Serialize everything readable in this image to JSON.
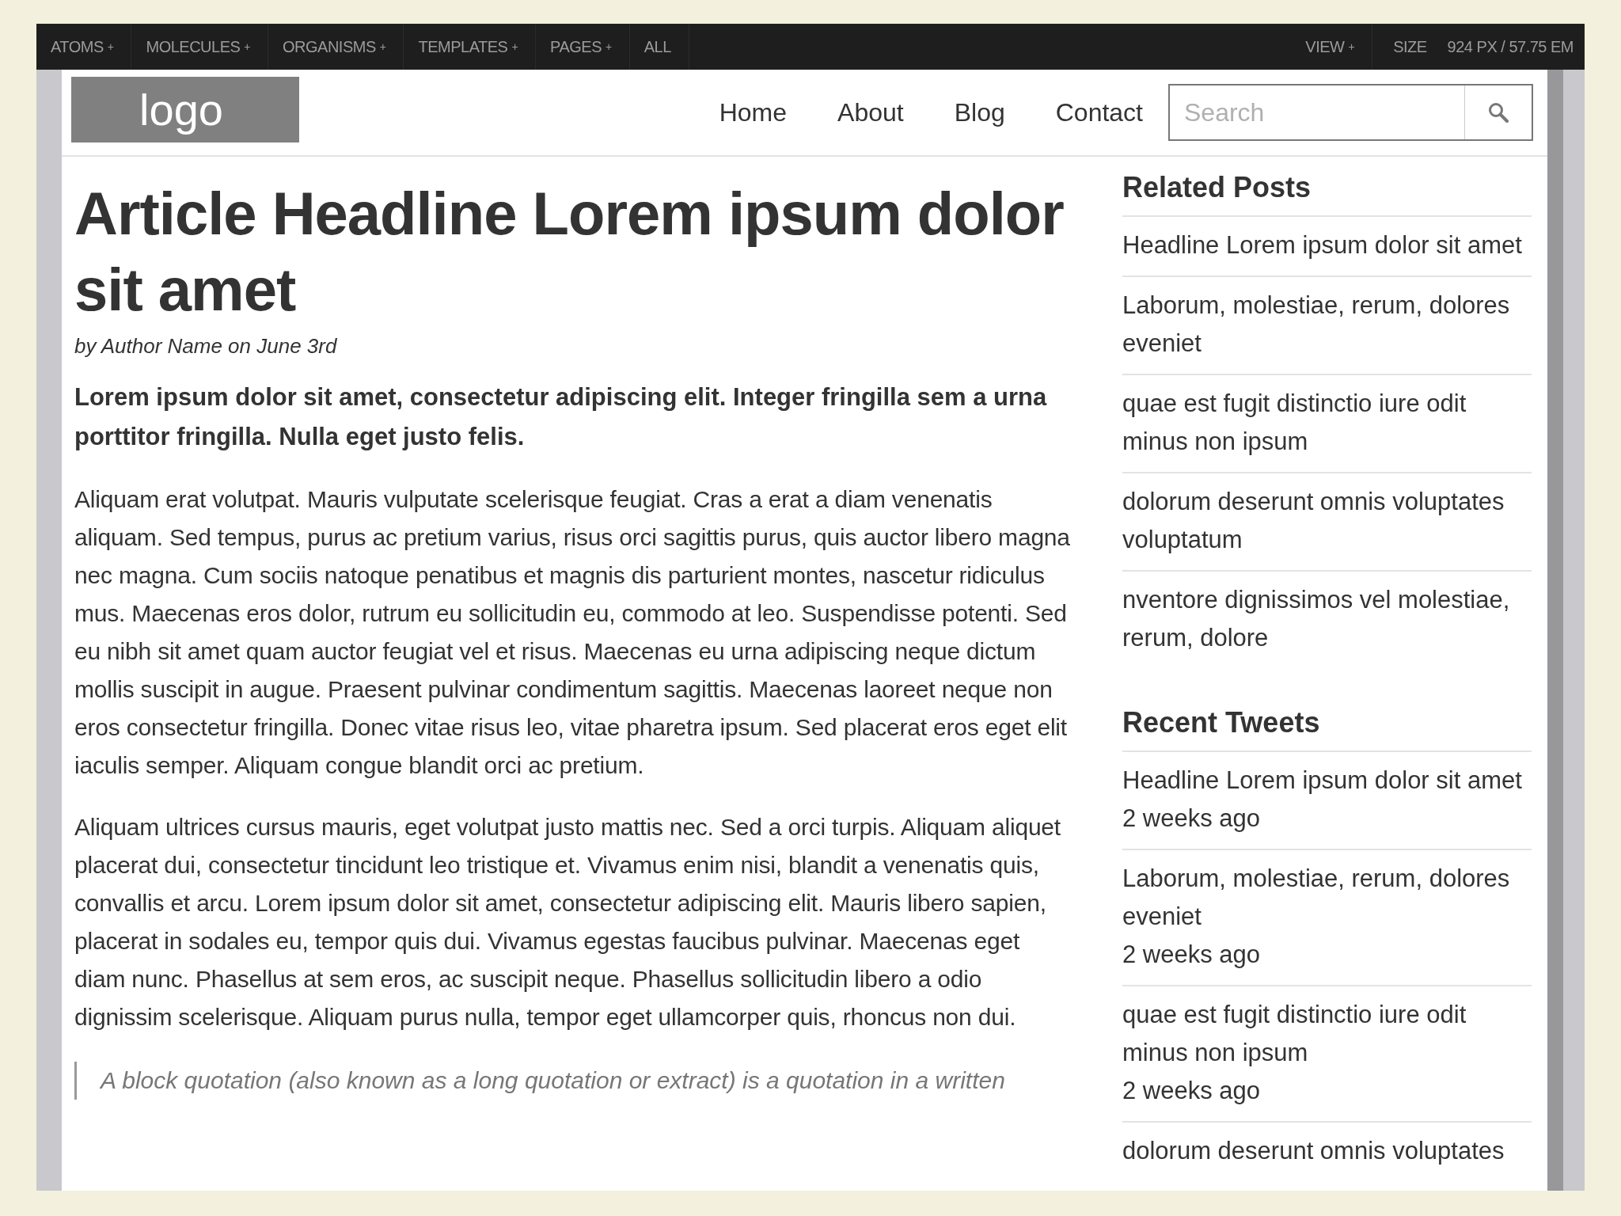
{
  "toolbar": {
    "menus": [
      {
        "label": "ATOMS",
        "toggle": "+"
      },
      {
        "label": "MOLECULES",
        "toggle": "+"
      },
      {
        "label": "ORGANISMS",
        "toggle": "+"
      },
      {
        "label": "TEMPLATES",
        "toggle": "+"
      },
      {
        "label": "PAGES",
        "toggle": "+"
      },
      {
        "label": "ALL"
      }
    ],
    "view": {
      "label": "VIEW",
      "toggle": "+"
    },
    "size": {
      "label": "SIZE",
      "reading": "924 PX / 57.75 EM"
    }
  },
  "header": {
    "logo": "logo",
    "nav": [
      "Home",
      "About",
      "Blog",
      "Contact"
    ],
    "search": {
      "placeholder": "Search"
    }
  },
  "article": {
    "headline": "Article Headline Lorem ipsum dolor sit amet",
    "byline": "by Author Name on June 3rd",
    "lead": "Lorem ipsum dolor sit amet, consectetur adipiscing elit. Integer fringilla sem a urna porttitor fringilla. Nulla eget justo felis.",
    "paragraphs": [
      "Aliquam erat volutpat. Mauris vulputate scelerisque feugiat. Cras a erat a diam venenatis aliquam. Sed tempus, purus ac pretium varius, risus orci sagittis purus, quis auctor libero magna nec magna. Cum sociis natoque penatibus et magnis dis parturient montes, nascetur ridiculus mus. Maecenas eros dolor, rutrum eu sollicitudin eu, commodo at leo. Suspendisse potenti. Sed eu nibh sit amet quam auctor feugiat vel et risus. Maecenas eu urna adipiscing neque dictum mollis suscipit in augue. Praesent pulvinar condimentum sagittis. Maecenas laoreet neque non eros consectetur fringilla. Donec vitae risus leo, vitae pharetra ipsum. Sed placerat eros eget elit iaculis semper. Aliquam congue blandit orci ac pretium.",
      "Aliquam ultrices cursus mauris, eget volutpat justo mattis nec. Sed a orci turpis. Aliquam aliquet placerat dui, consectetur tincidunt leo tristique et. Vivamus enim nisi, blandit a venenatis quis, convallis et arcu. Lorem ipsum dolor sit amet, consectetur adipiscing elit. Mauris libero sapien, placerat in sodales eu, tempor quis dui. Vivamus egestas faucibus pulvinar. Maecenas eget diam nunc. Phasellus at sem eros, ac suscipit neque. Phasellus sollicitudin libero a odio dignissim scelerisque. Aliquam purus nulla, tempor eget ullamcorper quis, rhoncus non dui."
    ],
    "blockquote": "A block quotation (also known as a long quotation or extract) is a quotation in a written"
  },
  "sidebar": [
    {
      "title": "Related Posts",
      "items": [
        {
          "text": "Headline Lorem ipsum dolor sit amet"
        },
        {
          "text": "Laborum, molestiae, rerum, dolores eveniet"
        },
        {
          "text": "quae est fugit distinctio iure odit minus non ipsum"
        },
        {
          "text": "dolorum deserunt omnis voluptates voluptatum"
        },
        {
          "text": "nventore dignissimos vel molestiae, rerum, dolore"
        }
      ]
    },
    {
      "title": "Recent Tweets",
      "items": [
        {
          "text": "Headline Lorem ipsum dolor sit amet",
          "time": "2 weeks ago"
        },
        {
          "text": "Laborum, molestiae, rerum, dolores eveniet",
          "time": "2 weeks ago"
        },
        {
          "text": "quae est fugit distinctio iure odit minus non ipsum",
          "time": "2 weeks ago"
        },
        {
          "text": "dolorum deserunt omnis voluptates"
        }
      ]
    }
  ]
}
